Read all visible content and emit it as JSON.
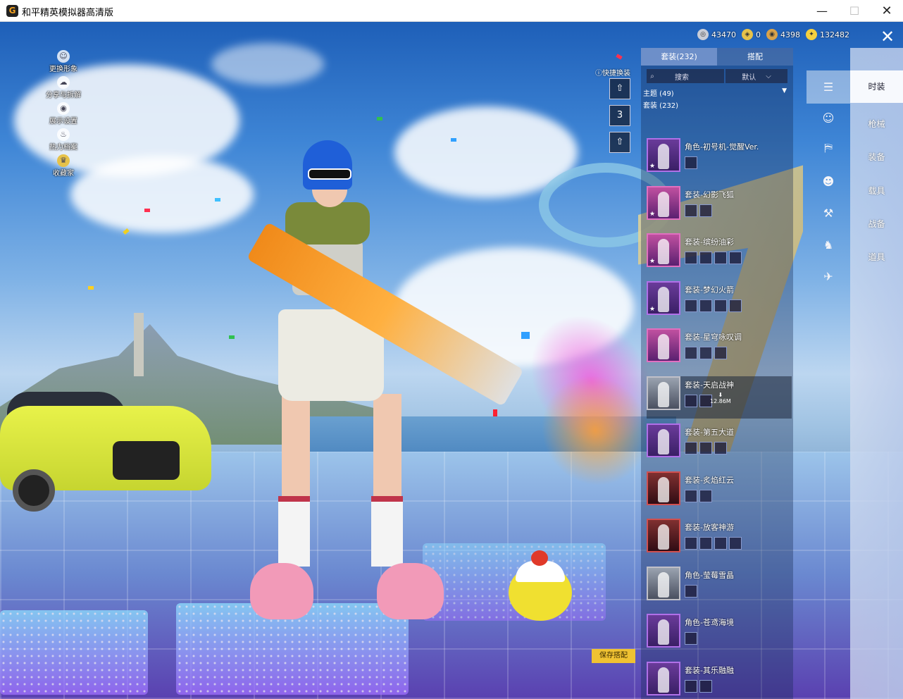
{
  "window": {
    "logo": "G",
    "title": "和平精英模拟器高清版",
    "minimize": "—",
    "maximize": "☐",
    "close": "✕"
  },
  "left_menu": [
    {
      "label": "更换形象",
      "icon": "avatar-icon",
      "glyph": "☺"
    },
    {
      "label": "分享与拆解",
      "icon": "share-icon",
      "glyph": "☁"
    },
    {
      "label": "展示设置",
      "icon": "eye-icon",
      "glyph": "◉"
    },
    {
      "label": "热力档案",
      "icon": "flame-icon",
      "glyph": "♨"
    },
    {
      "label": "收藏家",
      "icon": "collector-icon",
      "glyph": "♛"
    }
  ],
  "currency": [
    {
      "value": "43470",
      "icon": "silver-coin-icon",
      "color": "#c9ccd6",
      "glyph": "◎"
    },
    {
      "value": "0",
      "icon": "gold-badge-icon",
      "color": "#e6c24a",
      "glyph": "◈"
    },
    {
      "value": "4398",
      "icon": "bronze-coin-icon",
      "color": "#d9a24a",
      "glyph": "◉"
    },
    {
      "value": "132482",
      "icon": "gold-coin-icon",
      "color": "#f4d040",
      "glyph": "✦"
    }
  ],
  "quick_change": {
    "label": "快捷换装",
    "buttons": [
      "⇧",
      "3",
      "⇧"
    ]
  },
  "panel": {
    "tabs": [
      "套装(232)",
      "搭配"
    ],
    "search_label": "搜索",
    "sort_label": "默认",
    "theme_label": "主题 (49)",
    "suit_label": "套装 (232)",
    "outfits": [
      {
        "name": "角色-初号机-觉醒Ver.",
        "parts": 1
      },
      {
        "name": "套装-幻影飞狐",
        "parts": 2
      },
      {
        "name": "套装-缤纷油彩",
        "parts": 4
      },
      {
        "name": "套装-梦幻火箭",
        "parts": 4
      },
      {
        "name": "套装-星穹咏叹调",
        "parts": 3
      },
      {
        "name": "套装-天启战神",
        "parts": 2,
        "download": "12.86M"
      },
      {
        "name": "套装-第五大道",
        "parts": 3
      },
      {
        "name": "套装-炙焰红云",
        "parts": 2
      },
      {
        "name": "套装-放客神游",
        "parts": 4
      },
      {
        "name": "角色-莹莓雪晶",
        "parts": 1
      },
      {
        "name": "角色-苍鸢海境",
        "parts": 1
      },
      {
        "name": "套装-其乐融融",
        "parts": 2
      }
    ]
  },
  "save_button": "保存搭配",
  "categories": [
    {
      "label": "时装",
      "icon": "fashion-icon",
      "glyph": "☰"
    },
    {
      "label": "枪械",
      "icon": "gun-icon",
      "glyph": "⚔"
    },
    {
      "label": "装备",
      "icon": "gear-icon",
      "glyph": "⛨"
    },
    {
      "label": "载具",
      "icon": "vehicle-icon",
      "glyph": "⛟"
    },
    {
      "label": "战备",
      "icon": "supply-icon",
      "glyph": "✈"
    },
    {
      "label": "道具",
      "icon": "item-icon",
      "glyph": "❖"
    }
  ],
  "side_icons": [
    "☺",
    "⛿",
    "☻",
    "⚒",
    "♞",
    "✈"
  ],
  "close_label": "✕"
}
